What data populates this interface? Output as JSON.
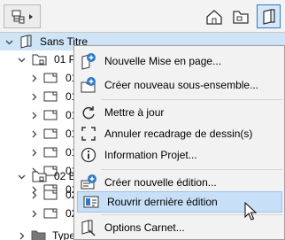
{
  "toolbar": {
    "left_button_icon": "hierarchy-dropdown-icon",
    "mode_buttons": [
      {
        "icon": "project-map-icon",
        "active": false
      },
      {
        "icon": "view-map-icon",
        "active": false
      },
      {
        "icon": "layout-book-icon",
        "active": true
      }
    ]
  },
  "tree": {
    "root": {
      "label": "Sans Titre",
      "icon": "layout-book-icon"
    },
    "items": [
      {
        "label": "01 PEI",
        "type": "subset",
        "expanded": true
      },
      {
        "label": "01-0",
        "type": "layout"
      },
      {
        "label": "01-0",
        "type": "layout"
      },
      {
        "label": "01-0",
        "type": "layout"
      },
      {
        "label": "01-0",
        "type": "layout"
      },
      {
        "label": "01-0",
        "type": "layout"
      },
      {
        "label": "01-0",
        "type": "layout"
      },
      {
        "label": "01-0",
        "type": "layout"
      },
      {
        "label": "02 EX",
        "type": "subset",
        "expanded": true
      },
      {
        "label": "02-0",
        "type": "layout"
      },
      {
        "label": "02-0",
        "type": "layout"
      },
      {
        "label": "Type",
        "type": "folder"
      }
    ]
  },
  "menu": {
    "items": [
      {
        "label": "Nouvelle Mise en page...",
        "icon": "new-layout-icon"
      },
      {
        "label": "Créer nouveau sous-ensemble...",
        "icon": "new-subset-icon"
      },
      {
        "label": "Mettre à jour",
        "icon": "refresh-icon"
      },
      {
        "label": "Annuler recadrage de dessin(s)",
        "icon": "crop-icon"
      },
      {
        "label": "Information Projet...",
        "icon": "info-icon"
      },
      {
        "label": "Créer nouvelle édition...",
        "icon": "new-issue-icon"
      },
      {
        "label": "Rouvrir dernière édition",
        "icon": "reopen-issue-icon",
        "highlighted": true
      },
      {
        "label": "Options Carnet...",
        "icon": "book-options-icon"
      }
    ]
  },
  "colors": {
    "selection": "#cfe4f7",
    "menu_highlight": "#c7e0f7",
    "accent": "#2b79c7"
  }
}
